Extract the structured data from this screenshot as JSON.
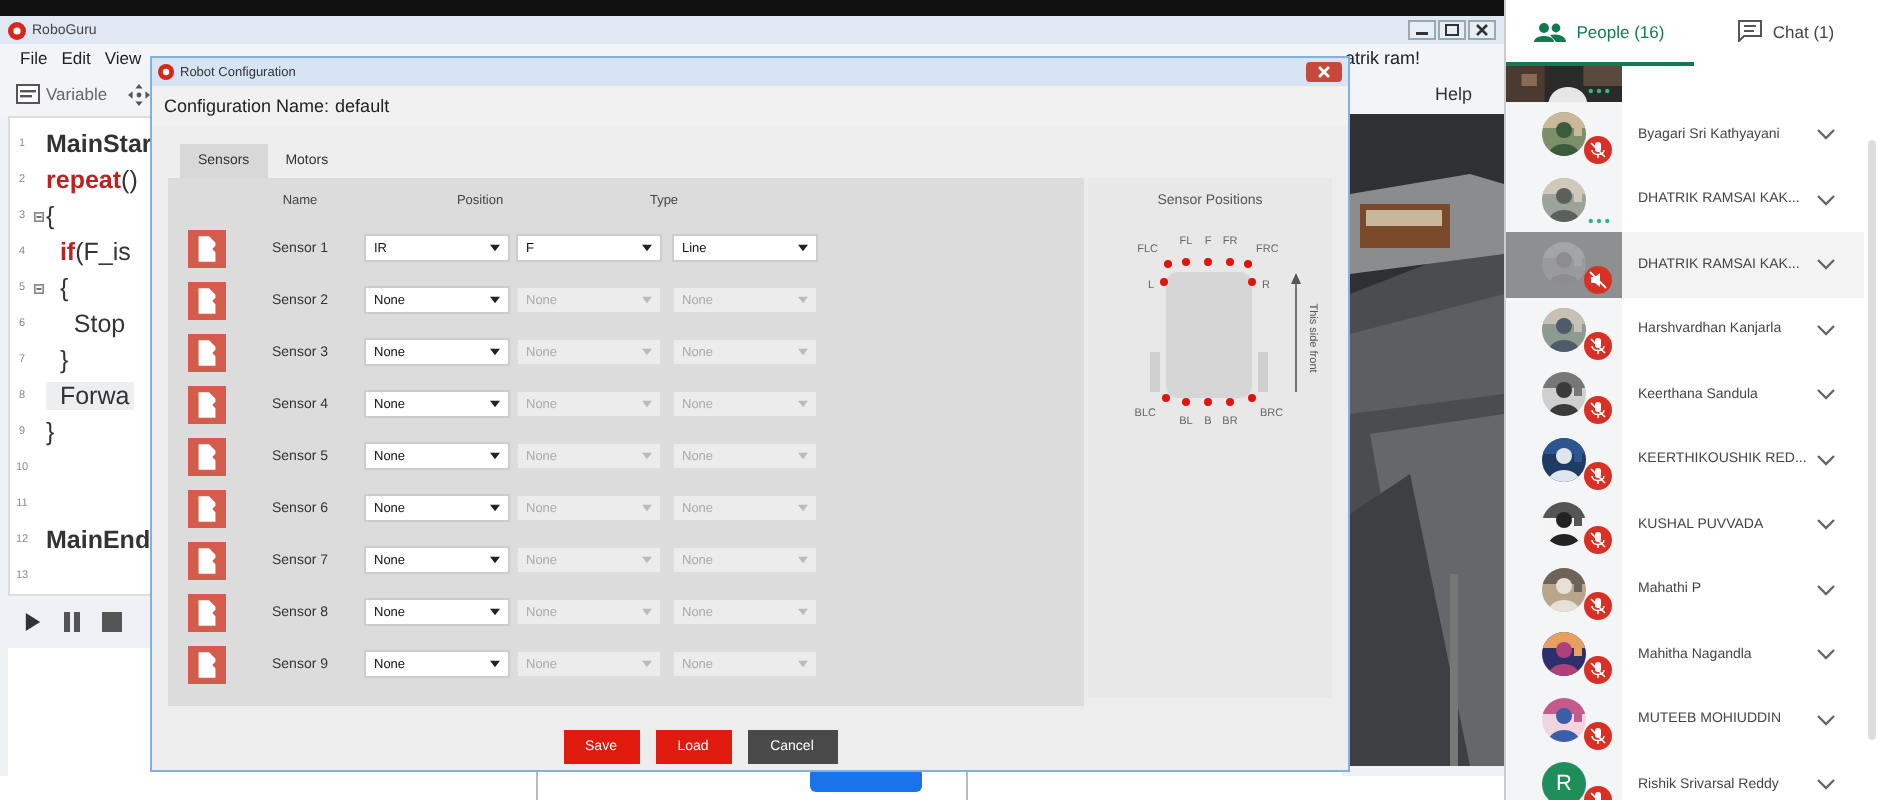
{
  "app_window": {
    "title": "RoboGuru",
    "menu": [
      "File",
      "Edit",
      "View"
    ],
    "toolbar": [
      {
        "label": "Variable"
      }
    ],
    "greeting": "atrik ram!",
    "help": "Help",
    "code_lines": [
      {
        "number": "1",
        "parts": [
          {
            "text": "MainStar",
            "kind": "keyword"
          }
        ]
      },
      {
        "number": "2",
        "parts": [
          {
            "text": "repeat",
            "kind": "red"
          },
          {
            "text": "()",
            "kind": "plain"
          }
        ]
      },
      {
        "number": "3",
        "fold": true,
        "parts": [
          {
            "text": "{",
            "kind": "plain"
          }
        ]
      },
      {
        "number": "4",
        "parts": [
          {
            "text": "  if",
            "kind": "red"
          },
          {
            "text": "(F_is",
            "kind": "plain"
          }
        ]
      },
      {
        "number": "5",
        "fold": true,
        "parts": [
          {
            "text": "  {",
            "kind": "plain"
          }
        ]
      },
      {
        "number": "6",
        "parts": [
          {
            "text": "    Stop",
            "kind": "plain"
          }
        ]
      },
      {
        "number": "7",
        "parts": [
          {
            "text": "  }",
            "kind": "plain"
          }
        ]
      },
      {
        "number": "8",
        "current": true,
        "parts": [
          {
            "text": "  Forwa",
            "kind": "plain"
          }
        ]
      },
      {
        "number": "9",
        "parts": [
          {
            "text": "}",
            "kind": "plain"
          }
        ]
      },
      {
        "number": "10"
      },
      {
        "number": "11"
      },
      {
        "number": "12",
        "parts": [
          {
            "text": "MainEnd",
            "kind": "keyword"
          }
        ]
      },
      {
        "number": "13"
      }
    ]
  },
  "dialog": {
    "title": "Robot Configuration",
    "config_label": "Configuration Name:",
    "config_value": "default",
    "tabs": [
      {
        "label": "Sensors",
        "selected": true
      },
      {
        "label": "Motors",
        "selected": false
      }
    ],
    "column_headers": [
      "Name",
      "Position",
      "Type"
    ],
    "sensors": [
      {
        "name": "Sensor 1",
        "selects": [
          {
            "value": "IR",
            "disabled": false
          },
          {
            "value": "F",
            "disabled": false
          },
          {
            "value": "Line",
            "disabled": false
          }
        ]
      },
      {
        "name": "Sensor 2",
        "selects": [
          {
            "value": "None",
            "disabled": false
          },
          {
            "value": "None",
            "disabled": true
          },
          {
            "value": "None",
            "disabled": true
          }
        ]
      },
      {
        "name": "Sensor 3",
        "selects": [
          {
            "value": "None",
            "disabled": false
          },
          {
            "value": "None",
            "disabled": true
          },
          {
            "value": "None",
            "disabled": true
          }
        ]
      },
      {
        "name": "Sensor 4",
        "selects": [
          {
            "value": "None",
            "disabled": false
          },
          {
            "value": "None",
            "disabled": true
          },
          {
            "value": "None",
            "disabled": true
          }
        ]
      },
      {
        "name": "Sensor 5",
        "selects": [
          {
            "value": "None",
            "disabled": false
          },
          {
            "value": "None",
            "disabled": true
          },
          {
            "value": "None",
            "disabled": true
          }
        ]
      },
      {
        "name": "Sensor 6",
        "selects": [
          {
            "value": "None",
            "disabled": false
          },
          {
            "value": "None",
            "disabled": true
          },
          {
            "value": "None",
            "disabled": true
          }
        ]
      },
      {
        "name": "Sensor 7",
        "selects": [
          {
            "value": "None",
            "disabled": false
          },
          {
            "value": "None",
            "disabled": true
          },
          {
            "value": "None",
            "disabled": true
          }
        ]
      },
      {
        "name": "Sensor 8",
        "selects": [
          {
            "value": "None",
            "disabled": false
          },
          {
            "value": "None",
            "disabled": true
          },
          {
            "value": "None",
            "disabled": true
          }
        ]
      },
      {
        "name": "Sensor 9",
        "selects": [
          {
            "value": "None",
            "disabled": false
          },
          {
            "value": "None",
            "disabled": true
          },
          {
            "value": "None",
            "disabled": true
          }
        ]
      }
    ],
    "sensor_positions": {
      "title": "Sensor Positions",
      "front_note": "This side front",
      "points": [
        "FLC",
        "FL",
        "F",
        "FR",
        "FRC",
        "L",
        "R",
        "BLC",
        "BL",
        "B",
        "BR",
        "BRC"
      ]
    },
    "buttons": [
      {
        "label": "Save",
        "kind": "primary"
      },
      {
        "label": "Load",
        "kind": "primary"
      },
      {
        "label": "Cancel",
        "kind": "secondary"
      }
    ]
  },
  "people_panel": {
    "tabs": [
      {
        "label": "People (16)",
        "kind": "people",
        "selected": true
      },
      {
        "label": "Chat (1)",
        "kind": "chat",
        "selected": false
      }
    ],
    "people": [
      {
        "avatar": {
          "kind": "video"
        },
        "mic": {
          "kind": "speaking"
        },
        "selected": false
      },
      {
        "name": "Byagari Sri Kathyayani",
        "mic": {
          "kind": "muted"
        },
        "selected": false
      },
      {
        "name": "DHATRIK RAMSAI KAK...",
        "mic": {
          "kind": "speaking"
        },
        "selected": false
      },
      {
        "name": "DHATRIK RAMSAI KAK...",
        "mic": {
          "kind": "audio_off"
        },
        "selected": true
      },
      {
        "name": "Harshvardhan Kanjarla",
        "mic": {
          "kind": "muted"
        },
        "selected": false
      },
      {
        "name": "Keerthana Sandula",
        "mic": {
          "kind": "muted"
        },
        "selected": false
      },
      {
        "name": "KEERTHIKOUSHIK RED...",
        "mic": {
          "kind": "muted"
        },
        "selected": false
      },
      {
        "name": "KUSHAL PUVVADA",
        "mic": {
          "kind": "muted"
        },
        "selected": false
      },
      {
        "name": "Mahathi P",
        "mic": {
          "kind": "muted"
        },
        "selected": false
      },
      {
        "name": "Mahitha Nagandla",
        "mic": {
          "kind": "muted"
        },
        "selected": false
      },
      {
        "name": "MUTEEB MOHIUDDIN",
        "mic": {
          "kind": "muted"
        },
        "selected": false
      },
      {
        "name": "Rishik Srivarsal Reddy",
        "avatar": {
          "kind": "letter",
          "initial": "R"
        },
        "mic": {
          "kind": "muted"
        },
        "selected": false
      }
    ]
  }
}
